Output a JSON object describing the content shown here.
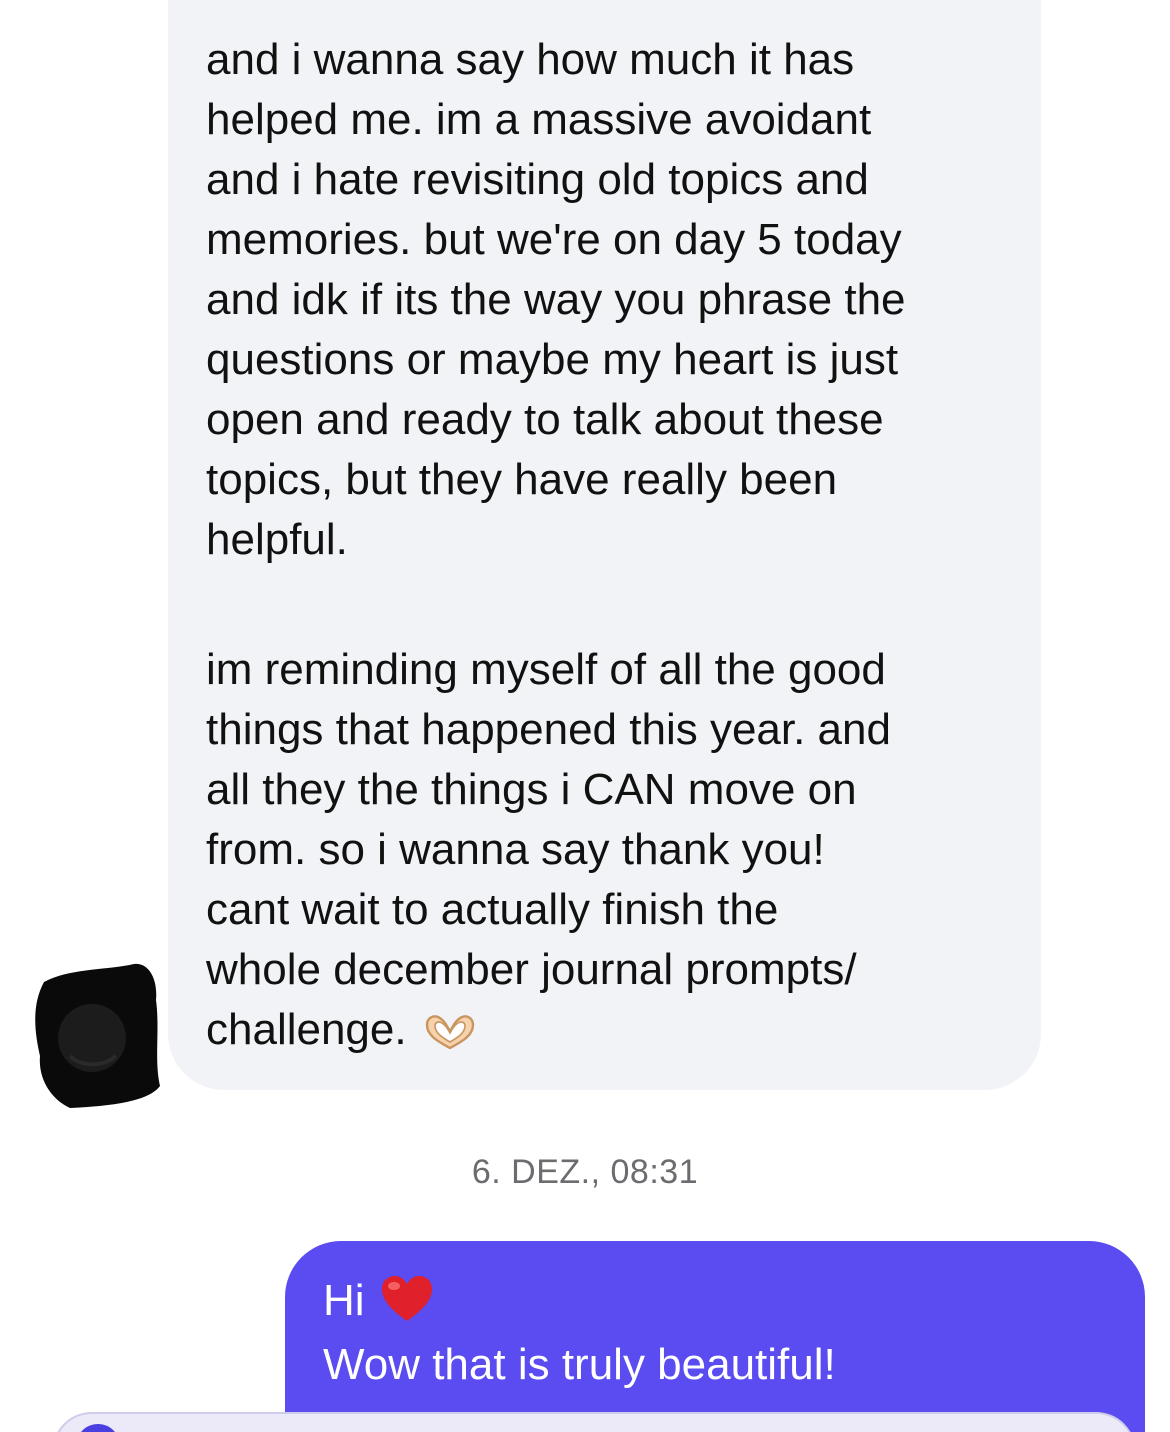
{
  "thread": {
    "incoming_message": {
      "paragraph_1": "and i wanna say how much it has\nhelped me. im a massive avoidant\nand i hate revisiting old topics and\nmemories. but we're on day 5 today\nand idk if its the way you phrase the\nquestions or maybe my heart is just\nopen and ready to talk about these\ntopics, but they have really been\nhelpful.",
      "paragraph_2": "im reminding myself of all the good\nthings that happened this year. and\nall they the things i CAN move on\nfrom. so i wanna say thank you!\ncant wait to actually finish the\nwhole december journal prompts/\nchallenge.",
      "emoji_icon": "heart-hands-icon"
    },
    "timestamp": "6. DEZ., 08:31",
    "outgoing_message": {
      "line_1": "Hi",
      "line_1_emoji_icon": "red-heart-icon",
      "line_2": "Wow that is truly beautiful!"
    }
  },
  "colors": {
    "incoming_bubble": "#f2f3f6",
    "outgoing_bubble": "#5a4cf0",
    "timestamp_text": "#6b6b70",
    "heart": "#e0202a"
  }
}
